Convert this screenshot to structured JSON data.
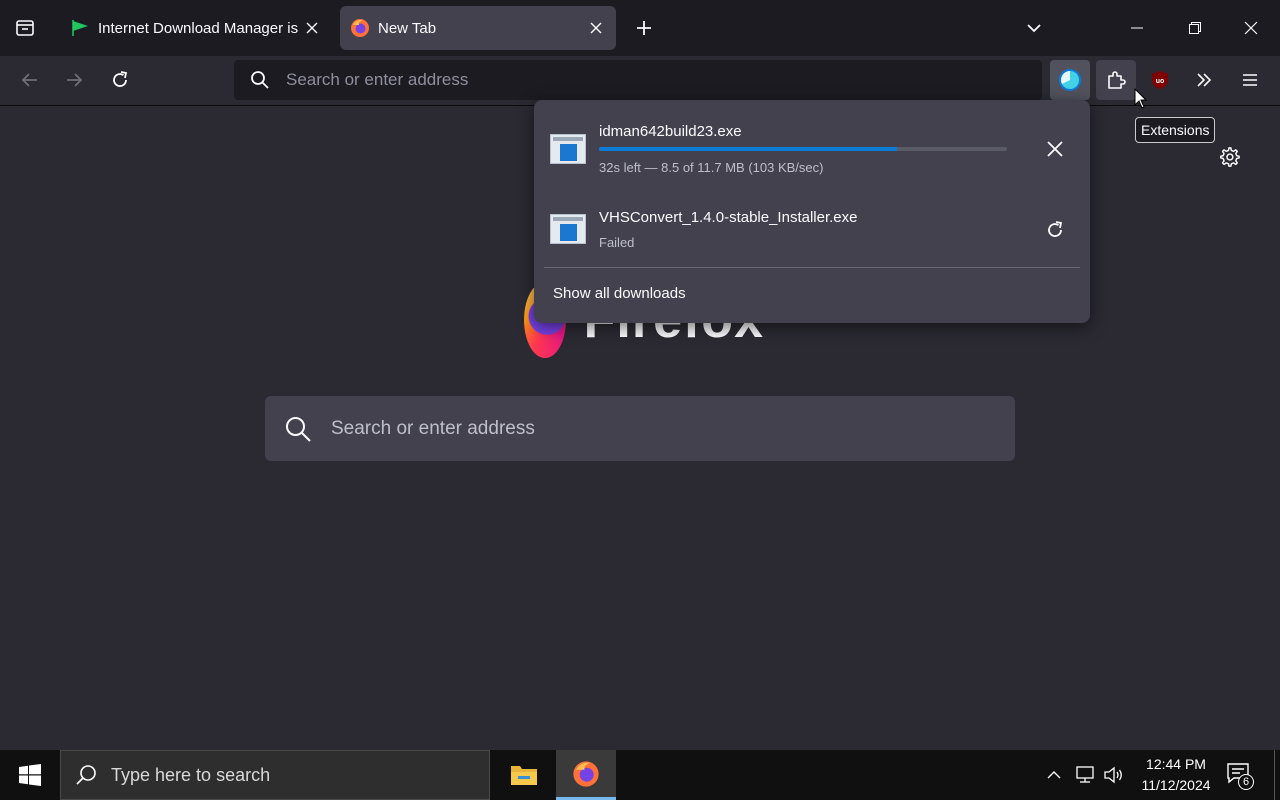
{
  "browser": {
    "tabs": [
      {
        "title": "Internet Download Manager is",
        "icon": "green-flag-icon",
        "active": false
      },
      {
        "title": "New Tab",
        "icon": "firefox-icon",
        "active": true
      }
    ],
    "urlbar": {
      "placeholder": "Search or enter address",
      "value": ""
    },
    "toolbar": {
      "downloads": "downloads-progress-icon",
      "extensions": "puzzle-icon",
      "ublock": "ublock-origin-icon",
      "overflow": "double-chevron-icon",
      "menu": "hamburger-icon"
    },
    "tooltip": "Extensions"
  },
  "page": {
    "logo_text": "Firefox",
    "search_placeholder": "Search or enter address"
  },
  "downloads": {
    "items": [
      {
        "name": "idman642build23.exe",
        "status": "32s left — 8.5 of 11.7 MB (103 KB/sec)",
        "progress": 0.73,
        "action": "cancel"
      },
      {
        "name": "VHSConvert_1.4.0-stable_Installer.exe",
        "status": "Failed",
        "action": "retry"
      }
    ],
    "show_all": "Show all downloads"
  },
  "taskbar": {
    "search_placeholder": "Type here to search",
    "time": "12:44 PM",
    "date": "11/12/2024",
    "notifications": "6"
  },
  "colors": {
    "accent": "#0b7bd5",
    "page_bg": "#2b2a33",
    "panel_bg": "#42414d"
  }
}
